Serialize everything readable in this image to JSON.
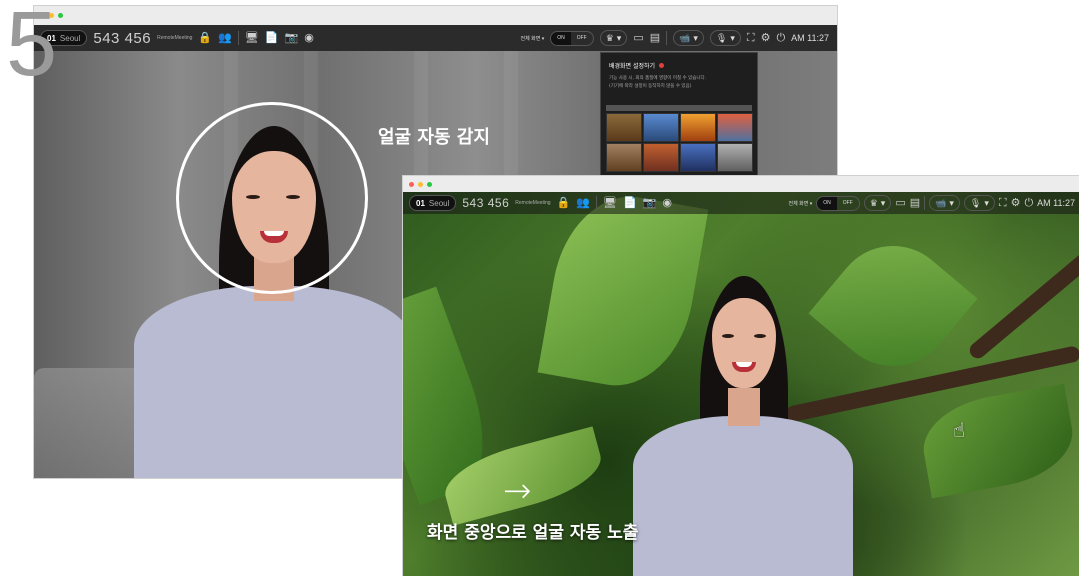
{
  "step_number": "5",
  "window_back": {
    "room_number": "01",
    "room_name": "Seoul",
    "meeting_id": "543 456",
    "meeting_label": "RemoteMeeting",
    "view_mode": "전체 화면 ▾",
    "toggle_on": "ON",
    "toggle_off": "OFF",
    "time": "AM 11:27",
    "face_detection_label": "얼굴 자동 감지",
    "background_panel": {
      "title": "배경화면 설정하기",
      "description_line1": "기능 사용 시, 회의 품질에 영향이 미칠 수 있습니다.",
      "description_line2": "(기기에 따라 설정이 동작하지 않을 수 있음)"
    }
  },
  "window_front": {
    "room_number": "01",
    "room_name": "Seoul",
    "meeting_id": "543 456",
    "meeting_label": "RemoteMeeting",
    "view_mode": "전체 화면 ▾",
    "toggle_on": "ON",
    "toggle_off": "OFF",
    "time": "AM 11:27",
    "caption": "화면 중앙으로 얼굴 자동 노출",
    "arrow": "→"
  },
  "icons": {
    "lock": "🔒",
    "people": "👥",
    "screen": "🖥",
    "document": "📄",
    "camera": "📷",
    "record": "◉",
    "crown": "♛",
    "layout": "▭",
    "layout2": "▤",
    "video": "📹",
    "mic": "🎙",
    "expand": "⛶",
    "settings": "⚙",
    "exit": "⏻",
    "hand_cursor": "☝",
    "dropdown": "▾"
  },
  "colors": {
    "toolbar_bg": "#2b2b2b",
    "close": "#ff5f57",
    "minimize": "#febc2e",
    "maximize": "#28c840",
    "circle": "#ffffff"
  }
}
